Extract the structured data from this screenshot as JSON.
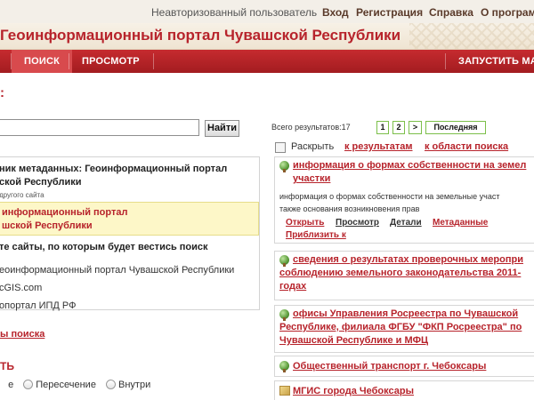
{
  "topbar": {
    "user_status": "Неавторизованный пользователь",
    "links": [
      "Вход",
      "Регистрация",
      "Справка",
      "О програми"
    ]
  },
  "header": {
    "title": "Геоинформационный портал Чувашской Республики"
  },
  "nav": {
    "tabs": [
      "ПОИСК",
      "ПРОСМОТР"
    ],
    "launch": "ЗАПУСТИТЬ МА"
  },
  "left": {
    "heading": ":",
    "search_button": "Найти",
    "search_value": "",
    "source_head_line1": "ник метаданных: Геоинформационный портал",
    "source_head_line2": "ской Республики",
    "source_note": "другого сайта",
    "selected_line1": "информационный портал",
    "selected_line2": "шской Республики",
    "sites_label": "те сайты, по которым будет вестись поиск",
    "sites": [
      "еоинформационный портал Чувашской Республики",
      "cGIS.com",
      "опортал ИПД РФ"
    ],
    "advanced_link": "ы поиска",
    "visual_label": "ТЬ",
    "radios": [
      "е",
      "Пересечение",
      "Внутри"
    ]
  },
  "right": {
    "total": "Всего результатов:17",
    "pager": [
      "1",
      "2",
      ">",
      "Последняя"
    ],
    "expand_label": "Раскрыть",
    "to_results": "к результатам",
    "to_area": "к области поиска",
    "results": [
      {
        "title_line1": "информация о формах собственности на земел",
        "title_line2": "участки",
        "desc_line1": "информация о формах собственности на земельные участ",
        "desc_line2": "также основания возникновения прав",
        "actions": [
          "Открыть",
          "Просмотр",
          "Детали",
          "Метаданные"
        ],
        "zoom": "Приблизить к",
        "icon": "globe-icon"
      },
      {
        "title_line1": "сведения о результатах проверочных меропри",
        "title_line2": "соблюдению земельного законодательства 2011-",
        "title_line3": "годах",
        "icon": "globe-icon"
      },
      {
        "title_line1": "офисы Управления Росреестра по Чувашской",
        "title_line2": "Республике, филиала ФГБУ \"ФКП Росреестра\" по",
        "title_line3": "Чувашской Республике и МФЦ",
        "icon": "globe-icon"
      },
      {
        "title_line1": "Общественный транспорт г. Чебоксары",
        "icon": "globe-icon"
      },
      {
        "title_line1": "МГИС города Чебоксары",
        "icon": "map-icon"
      }
    ]
  },
  "colors": {
    "brand_red": "#b7232b",
    "nav_red": "#c62b2f",
    "highlight": "#fdf7c8"
  }
}
